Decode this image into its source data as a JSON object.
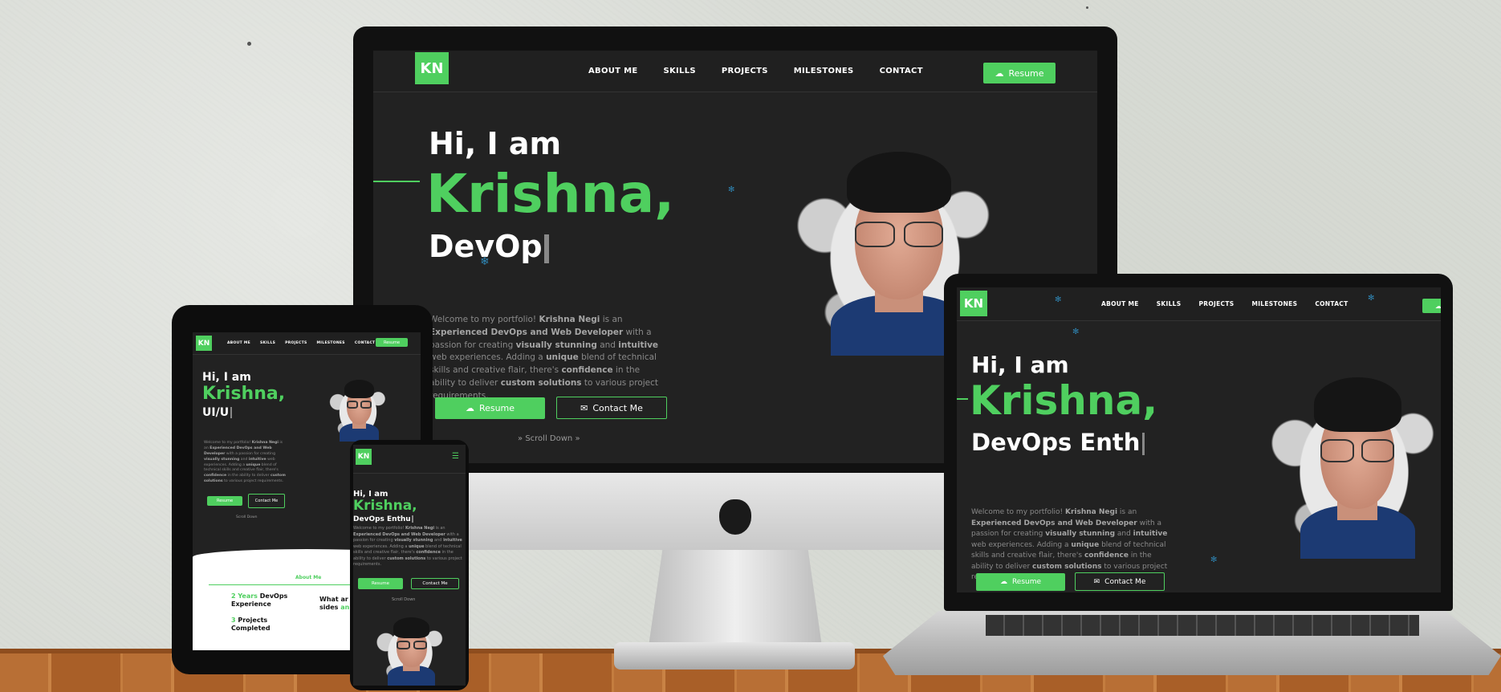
{
  "brand": {
    "logo": "KN",
    "accent": "#4fcf5f",
    "background": "#222222"
  },
  "nav": {
    "about": "About Me",
    "skills": "Skills",
    "projects": "Projects",
    "milestones": "Milestones",
    "contact": "Contact",
    "resume": "Resume"
  },
  "hero": {
    "greeting": "Hi, I am",
    "name": "Krishna,",
    "role_monitor": "DevOp",
    "role_laptop": "DevOps Enth",
    "role_tablet": "UI/U",
    "role_phone": "DevOps Enthu",
    "intro_1": "Welcome to my portfolio! ",
    "intro_name": "Krishna Negi",
    "intro_2": " is an ",
    "intro_exp": "Experienced DevOps and Web Developer",
    "intro_3": " with a passion for creating ",
    "intro_vis": "visually stunning",
    "intro_4": " and ",
    "intro_int": "intuitive",
    "intro_5": " web experiences. Adding a ",
    "intro_uni": "unique",
    "intro_6": " blend of technical skills and creative flair, there's ",
    "intro_conf": "confidence",
    "intro_7": " in the ability to deliver ",
    "intro_cust": "custom solutions",
    "intro_8": " to various project requirements.",
    "resume_button": "Resume",
    "contact_button": "Contact Me",
    "scroll": "Scroll Down"
  },
  "about": {
    "title": "About Me",
    "stat1_num": "2 Years",
    "stat1_a": "DevOps",
    "stat1_b": "Experience",
    "stat2_num": "3",
    "stat2_a": "Projects",
    "stat2_b": "Completed",
    "side_title_1": "What ar",
    "side_title_2": "sides",
    "side_title_3": "an"
  },
  "icons": [
    "cloud-download-icon",
    "mail-icon",
    "chevrons-down-icon",
    "hamburger-menu-icon",
    "apple-logo-icon",
    "sparkle-icon"
  ]
}
